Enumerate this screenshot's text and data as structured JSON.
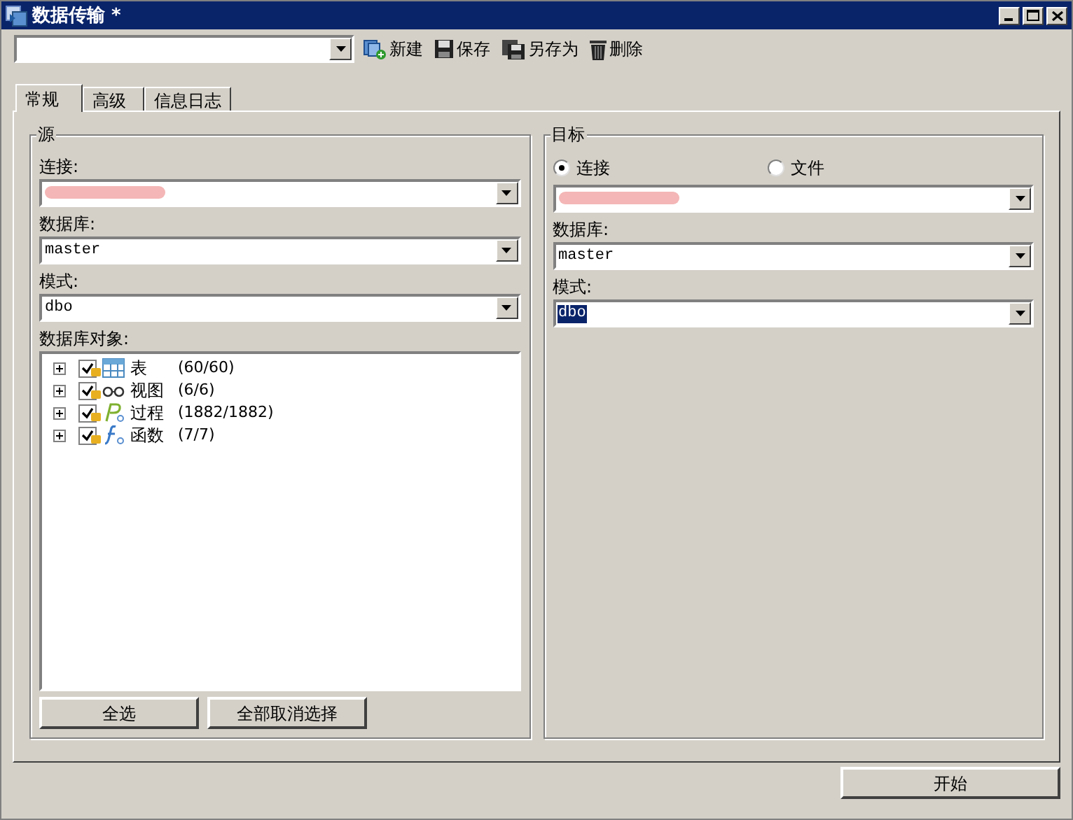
{
  "window": {
    "title": "数据传输 *"
  },
  "toolbar": {
    "buttons": [
      {
        "kind": "new",
        "label": "新建"
      },
      {
        "kind": "save",
        "label": "保存"
      },
      {
        "kind": "saveas",
        "label": "另存为"
      },
      {
        "kind": "delete",
        "label": "删除"
      }
    ]
  },
  "tabs": [
    {
      "label": "常规",
      "selected": true
    },
    {
      "label": "高级",
      "selected": false
    },
    {
      "label": "信息日志",
      "selected": false
    }
  ],
  "source": {
    "title": "源",
    "connection_label": "连接:",
    "database_label": "数据库:",
    "database": "master",
    "schema_label": "模式:",
    "schema": "dbo",
    "objects_label": "数据库对象:",
    "objects": [
      {
        "kind": "table",
        "label": "表",
        "count": "(60/60)",
        "checked": true,
        "expanded": false
      },
      {
        "kind": "view",
        "label": "视图",
        "count": "(6/6)",
        "checked": true,
        "expanded": false
      },
      {
        "kind": "procedure",
        "label": "过程",
        "count": "(1882/1882)",
        "checked": true,
        "expanded": false
      },
      {
        "kind": "function",
        "label": "函数",
        "count": "(7/7)",
        "checked": true,
        "expanded": false
      }
    ],
    "buttons": [
      "全选",
      "全部取消选择"
    ]
  },
  "target": {
    "title": "目标",
    "options": [
      {
        "label": "连接",
        "selected": true
      },
      {
        "label": "文件",
        "selected": false
      }
    ],
    "database_label": "数据库:",
    "database": "master",
    "schema_label": "模式:",
    "schema": "dbo",
    "schema_selected": true
  },
  "start_button": "开始"
}
